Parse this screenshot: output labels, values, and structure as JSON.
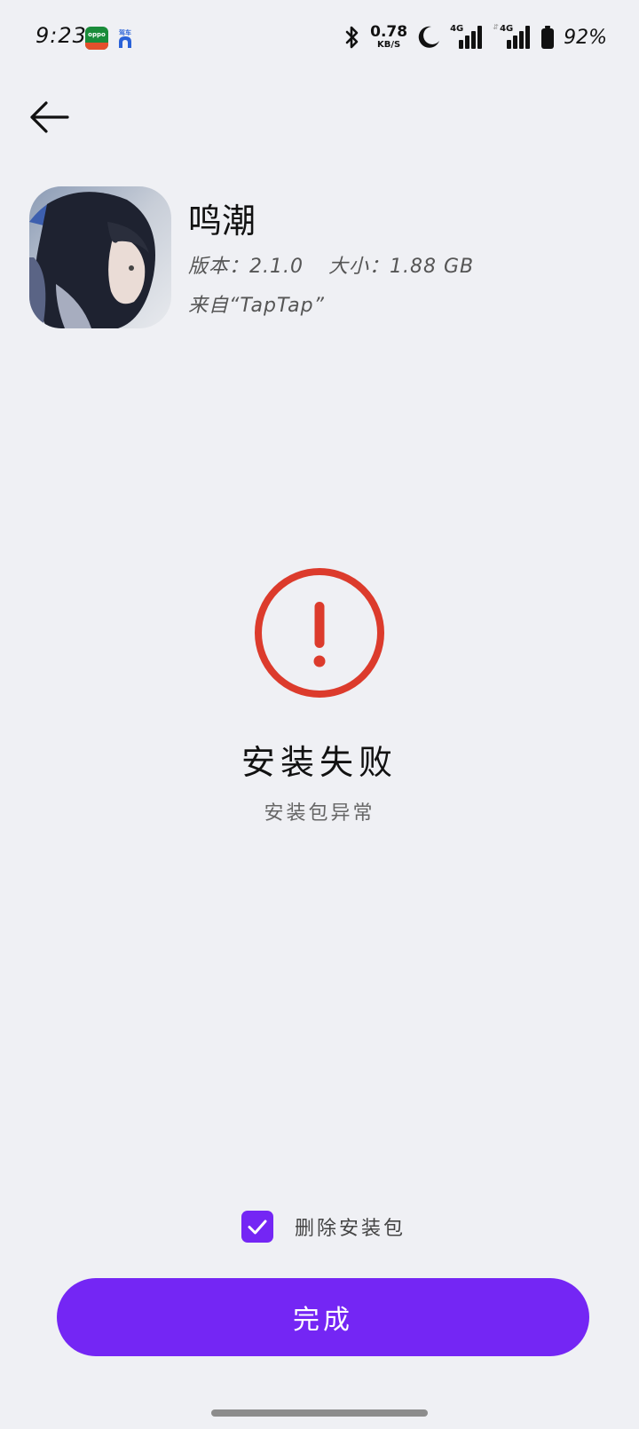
{
  "status_bar": {
    "time": "9:23",
    "notification_icons": [
      {
        "name": "oppo-app-icon",
        "color": "#1a8c3a",
        "label": "oppo"
      },
      {
        "name": "car-app-icon",
        "color": "#ffffff",
        "label": "驾车"
      }
    ],
    "net_speed_value": "0.78",
    "net_speed_unit": "KB/S",
    "signal_1_label": "4G",
    "signal_2_label": "4G",
    "battery_percent": "92%"
  },
  "app": {
    "name": "鸣潮",
    "version_label": "版本：2.1.0",
    "size_label": "大小：1.88 GB",
    "source": "来自“TapTap”"
  },
  "result": {
    "title": "安装失败",
    "subtitle": "安装包异常",
    "status_color": "#dc3b2c"
  },
  "options": {
    "delete_package_label": "删除安装包",
    "delete_package_checked": true
  },
  "actions": {
    "done_label": "完成",
    "accent_color": "#7426f4"
  }
}
